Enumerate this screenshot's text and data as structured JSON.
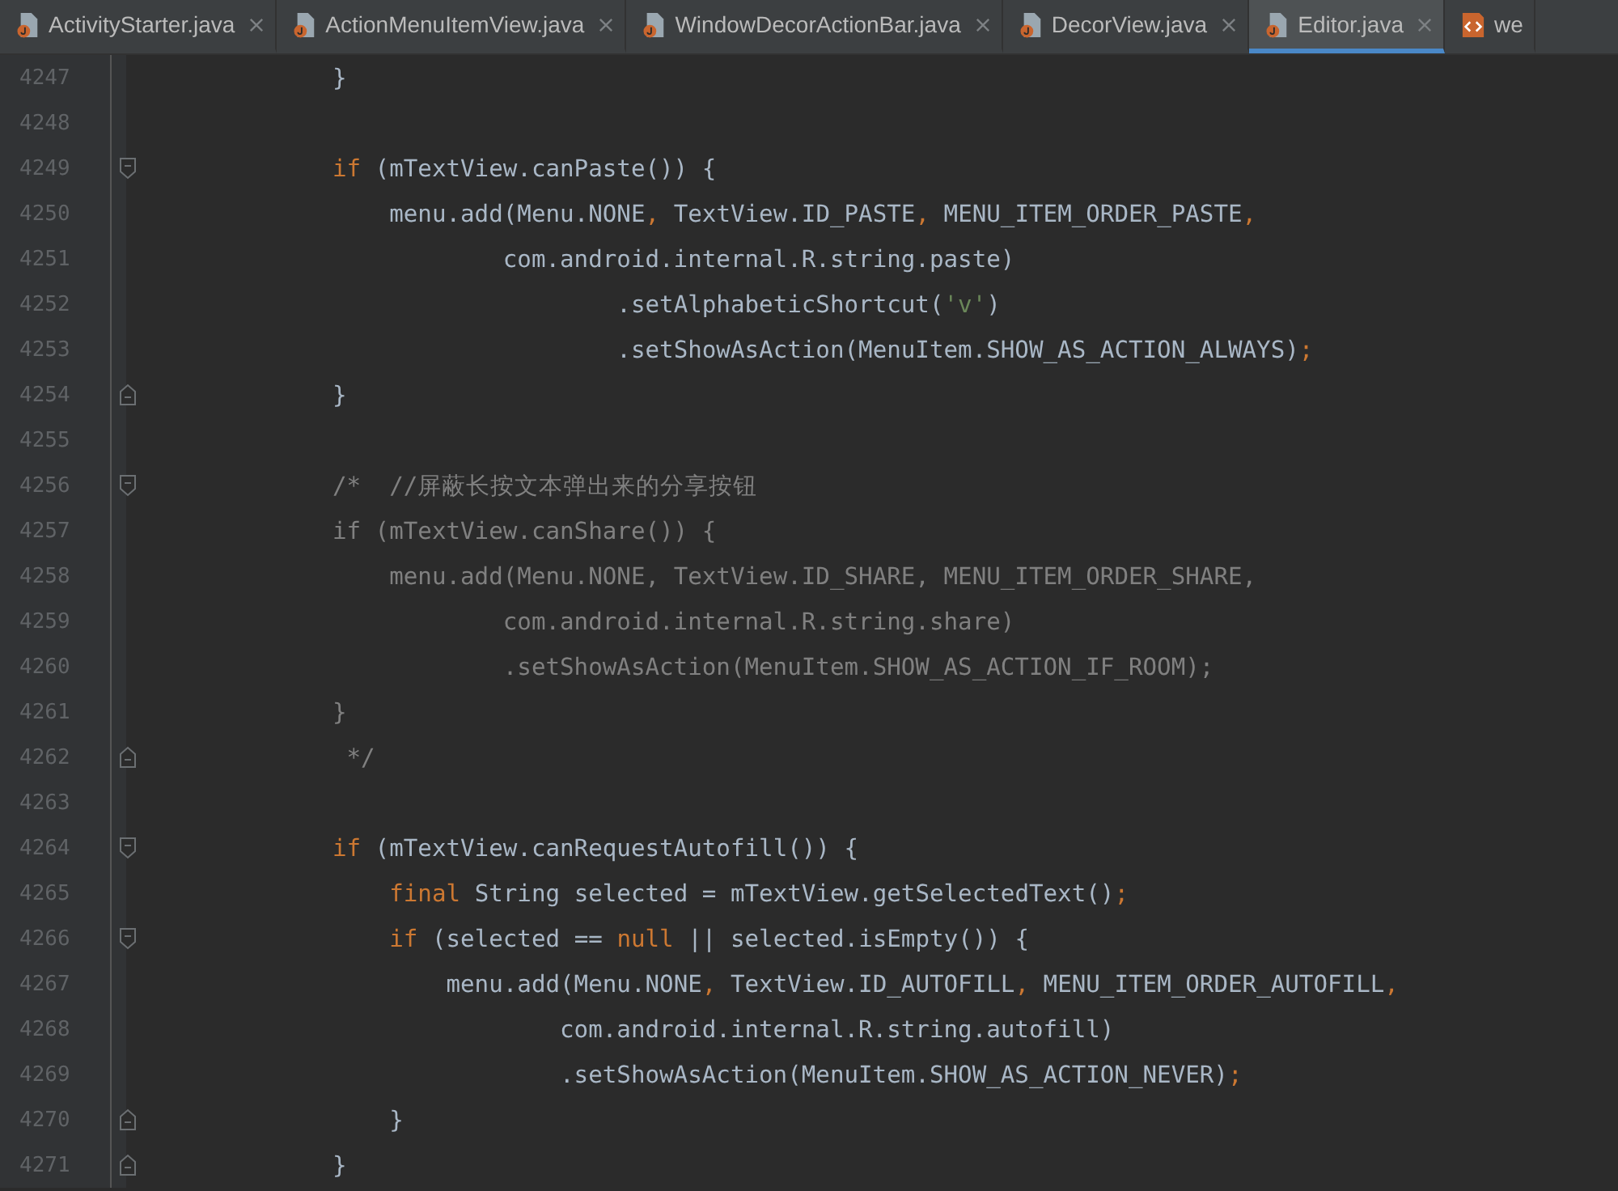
{
  "tabs": [
    {
      "label": "ActivityStarter.java",
      "kind": "java",
      "selected": false,
      "closable": true
    },
    {
      "label": "ActionMenuItemView.java",
      "kind": "java",
      "selected": false,
      "closable": true
    },
    {
      "label": "WindowDecorActionBar.java",
      "kind": "java",
      "selected": false,
      "closable": true
    },
    {
      "label": "DecorView.java",
      "kind": "java",
      "selected": false,
      "closable": true
    },
    {
      "label": "Editor.java",
      "kind": "java",
      "selected": true,
      "closable": true
    },
    {
      "label": "we",
      "kind": "html",
      "selected": false,
      "closable": false
    }
  ],
  "lines": [
    {
      "number": "4247",
      "tokens": [
        {
          "kind": "plain",
          "text": "            }"
        }
      ]
    },
    {
      "number": "4248"
    },
    {
      "number": "4249",
      "kind": "opener",
      "tokens": [
        {
          "kind": "keyword",
          "text": "            if"
        },
        {
          "kind": "plain",
          "text": " (mTextView.canPaste()) {"
        }
      ]
    },
    {
      "number": "4250",
      "tokens": [
        {
          "kind": "plain",
          "text": "                menu.add(Menu.NONE"
        },
        {
          "kind": "punct",
          "text": ","
        },
        {
          "kind": "plain",
          "text": " TextView.ID_PASTE"
        },
        {
          "kind": "punct",
          "text": ","
        },
        {
          "kind": "plain",
          "text": " MENU_ITEM_ORDER_PASTE"
        },
        {
          "kind": "punct",
          "text": ","
        }
      ]
    },
    {
      "number": "4251",
      "tokens": [
        {
          "kind": "plain",
          "text": "                        com.android.internal.R.string.paste)"
        }
      ]
    },
    {
      "number": "4252",
      "tokens": [
        {
          "kind": "plain",
          "text": "                                .setAlphabeticShortcut("
        },
        {
          "kind": "string",
          "text": "'v'"
        },
        {
          "kind": "plain",
          "text": ")"
        }
      ]
    },
    {
      "number": "4253",
      "tokens": [
        {
          "kind": "plain",
          "text": "                                .setShowAsAction(MenuItem.SHOW_AS_ACTION_ALWAYS)"
        },
        {
          "kind": "punct",
          "text": ";"
        }
      ]
    },
    {
      "number": "4254",
      "kind": "closer",
      "tokens": [
        {
          "kind": "plain",
          "text": "            }"
        }
      ]
    },
    {
      "number": "4255"
    },
    {
      "number": "4256",
      "kind": "opener",
      "tokens": [
        {
          "kind": "comment",
          "text": "            /*  //屏蔽长按文本弹出来的分享按钮"
        }
      ]
    },
    {
      "number": "4257",
      "tokens": [
        {
          "kind": "comment",
          "text": "            if (mTextView.canShare()) {"
        }
      ]
    },
    {
      "number": "4258",
      "tokens": [
        {
          "kind": "comment",
          "text": "                menu.add(Menu.NONE, TextView.ID_SHARE, MENU_ITEM_ORDER_SHARE,"
        }
      ]
    },
    {
      "number": "4259",
      "tokens": [
        {
          "kind": "comment",
          "text": "                        com.android.internal.R.string.share)"
        }
      ]
    },
    {
      "number": "4260",
      "tokens": [
        {
          "kind": "comment",
          "text": "                        .setShowAsAction(MenuItem.SHOW_AS_ACTION_IF_ROOM);"
        }
      ]
    },
    {
      "number": "4261",
      "tokens": [
        {
          "kind": "comment",
          "text": "            }"
        }
      ]
    },
    {
      "number": "4262",
      "kind": "closer",
      "tokens": [
        {
          "kind": "comment",
          "text": "             */"
        }
      ]
    },
    {
      "number": "4263"
    },
    {
      "number": "4264",
      "kind": "opener",
      "tokens": [
        {
          "kind": "keyword",
          "text": "            if"
        },
        {
          "kind": "plain",
          "text": " (mTextView.canRequestAutofill()) {"
        }
      ]
    },
    {
      "number": "4265",
      "tokens": [
        {
          "kind": "keyword",
          "text": "                final"
        },
        {
          "kind": "plain",
          "text": " String selected = mTextView.getSelectedText()"
        },
        {
          "kind": "punct",
          "text": ";"
        }
      ]
    },
    {
      "number": "4266",
      "kind": "opener",
      "tokens": [
        {
          "kind": "keyword",
          "text": "                if"
        },
        {
          "kind": "plain",
          "text": " (selected == "
        },
        {
          "kind": "keyword",
          "text": "null"
        },
        {
          "kind": "plain",
          "text": " || selected.isEmpty()) {"
        }
      ]
    },
    {
      "number": "4267",
      "tokens": [
        {
          "kind": "plain",
          "text": "                    menu.add(Menu.NONE"
        },
        {
          "kind": "punct",
          "text": ","
        },
        {
          "kind": "plain",
          "text": " TextView.ID_AUTOFILL"
        },
        {
          "kind": "punct",
          "text": ","
        },
        {
          "kind": "plain",
          "text": " MENU_ITEM_ORDER_AUTOFILL"
        },
        {
          "kind": "punct",
          "text": ","
        }
      ]
    },
    {
      "number": "4268",
      "tokens": [
        {
          "kind": "plain",
          "text": "                            com.android.internal.R.string.autofill)"
        }
      ]
    },
    {
      "number": "4269",
      "tokens": [
        {
          "kind": "plain",
          "text": "                            .setShowAsAction(MenuItem.SHOW_AS_ACTION_NEVER)"
        },
        {
          "kind": "punct",
          "text": ";"
        }
      ]
    },
    {
      "number": "4270",
      "kind": "closer",
      "tokens": [
        {
          "kind": "plain",
          "text": "                }"
        }
      ]
    },
    {
      "number": "4271",
      "kind": "closer",
      "tokens": [
        {
          "kind": "plain",
          "text": "            }"
        }
      ]
    }
  ]
}
